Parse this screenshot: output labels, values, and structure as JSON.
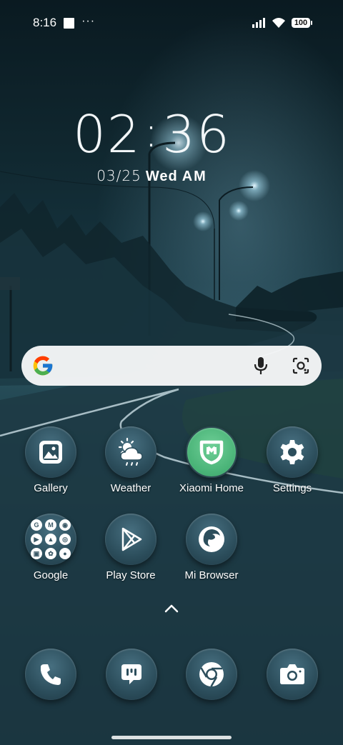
{
  "status_bar": {
    "time": "8:16",
    "more": "···",
    "battery": "100"
  },
  "clock": {
    "hours": "02",
    "minutes": "36",
    "date": "03/25",
    "weekday": "Wed",
    "ampm": "AM"
  },
  "search": {
    "placeholder": ""
  },
  "apps": [
    {
      "label": "Gallery",
      "icon": "gallery-icon"
    },
    {
      "label": "Weather",
      "icon": "weather-icon"
    },
    {
      "label": "Xiaomi Home",
      "icon": "xiaomi-home-icon"
    },
    {
      "label": "Settings",
      "icon": "gear-icon"
    },
    {
      "label": "Google",
      "icon": "google-folder-icon"
    },
    {
      "label": "Play Store",
      "icon": "play-store-icon"
    },
    {
      "label": "Mi Browser",
      "icon": "mi-browser-icon"
    }
  ],
  "folder_glyphs": [
    "G",
    "M",
    "◉",
    "▶",
    "▲",
    "◎",
    "▣",
    "✿",
    "●"
  ],
  "dock": [
    {
      "icon": "phone-icon"
    },
    {
      "icon": "messaging-icon"
    },
    {
      "icon": "chrome-icon"
    },
    {
      "icon": "camera-icon"
    }
  ],
  "colors": {
    "icon_bg": "#2c4e5c",
    "xiaomi_green": "#48b276",
    "search_bg": "#f6f7f8"
  }
}
